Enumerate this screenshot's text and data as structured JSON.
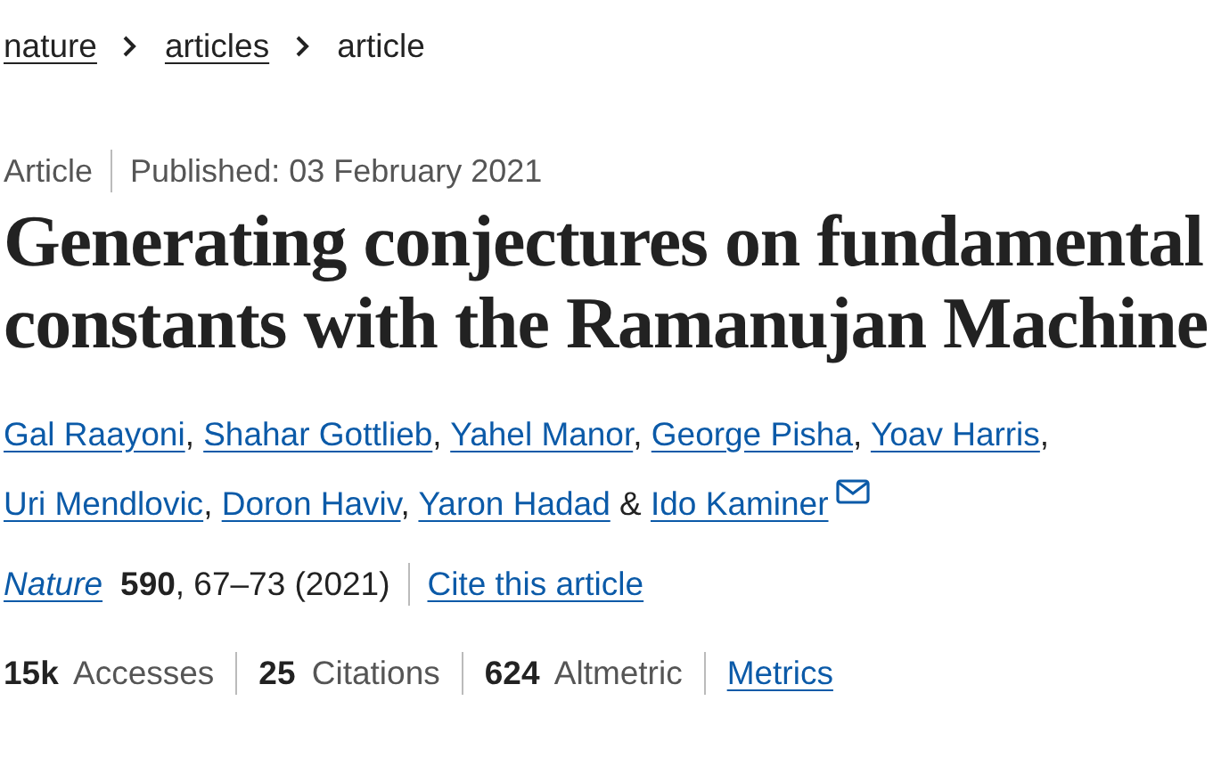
{
  "breadcrumb": [
    {
      "label": "nature",
      "kind": "link"
    },
    {
      "label": "articles",
      "kind": "link"
    },
    {
      "label": "article",
      "kind": "current"
    }
  ],
  "meta": {
    "type": "Article",
    "published": "Published: 03 February 2021"
  },
  "title": "Generating conjectures on fundamental constants with the Ramanujan Machine",
  "authors": [
    {
      "name": "Gal Raayoni",
      "separator": ","
    },
    {
      "name": "Shahar Gottlieb",
      "separator": ","
    },
    {
      "name": "Yahel Manor",
      "separator": ","
    },
    {
      "name": "George Pisha",
      "separator": ","
    },
    {
      "name": "Yoav Harris",
      "separator": ","
    },
    {
      "name": "Uri Mendlovic",
      "separator": ","
    },
    {
      "name": "Doron Haviv",
      "separator": ","
    },
    {
      "name": "Yaron Hadad",
      "separator": "&"
    },
    {
      "name": "Ido Kaminer",
      "contact": true
    }
  ],
  "citation": {
    "journal": "Nature",
    "volume": "590",
    "pages": ", 67–73 (2021)",
    "cite": "Cite this article"
  },
  "metrics": [
    "**15k** Accesses",
    "**25** Citations",
    "**624** Altmetric"
  ],
  "metrics_link": "Metrics"
}
